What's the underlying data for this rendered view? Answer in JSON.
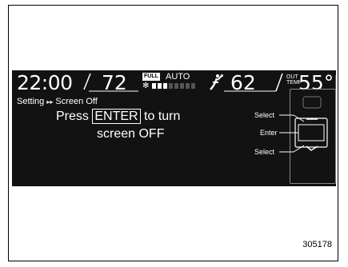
{
  "status_bar": {
    "clock": "22:00",
    "temp_left": "72",
    "fan_badge": "FULL",
    "mode": "AUTO",
    "fan_level": 3,
    "fan_level_max": 8,
    "temp_right": "62",
    "outside_label_line1": "OUT",
    "outside_label_line2": "TEMP",
    "outside_temp": "55°F"
  },
  "breadcrumb": {
    "root": "Setting",
    "separator": "▸▸",
    "current": "Screen Off"
  },
  "message": {
    "prefix": "Press",
    "key": "ENTER",
    "suffix": "to turn",
    "line2": "screen OFF"
  },
  "controls": {
    "select_up": "Select",
    "enter": "Enter",
    "select_down": "Select"
  },
  "figure_id": "305178",
  "colors": {
    "screen_bg": "#121212",
    "text": "#ffffff",
    "fan_bar_on": "#ffffff",
    "fan_bar_off": "#555555"
  }
}
